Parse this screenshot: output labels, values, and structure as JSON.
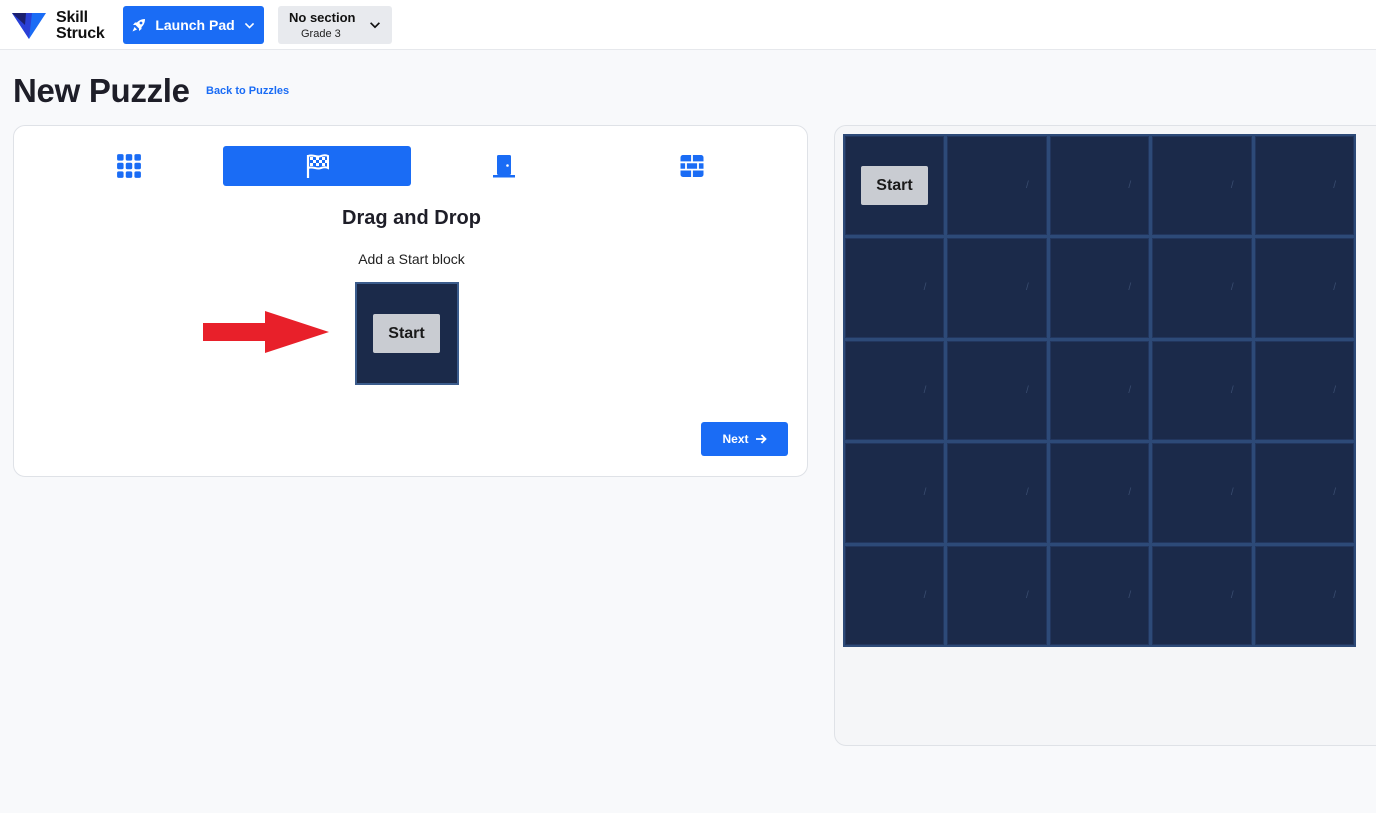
{
  "app": {
    "logo_line1": "Skill",
    "logo_line2": "Struck",
    "brand_color": "#1a6cf5"
  },
  "header": {
    "launch_label": "Launch Pad",
    "section_title": "No section",
    "section_grade": "Grade 3"
  },
  "page": {
    "title": "New Puzzle",
    "back_link": "Back to Puzzles"
  },
  "tabs": [
    {
      "name": "grid-icon",
      "active": false
    },
    {
      "name": "flag-icon",
      "active": true
    },
    {
      "name": "door-icon",
      "active": false
    },
    {
      "name": "wall-icon",
      "active": false
    }
  ],
  "step": {
    "title": "Drag and Drop",
    "subtitle": "Add a Start block",
    "block_label": "Start",
    "next_label": "Next"
  },
  "board": {
    "rows": 5,
    "cols": 5,
    "cell_mark": "/",
    "start_row": 0,
    "start_col": 0,
    "start_label": "Start"
  }
}
